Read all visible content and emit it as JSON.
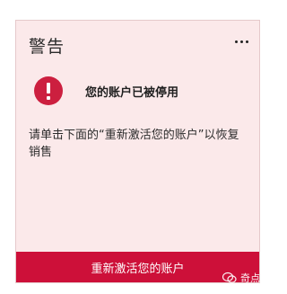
{
  "card": {
    "title": "警告",
    "alert_message": "您的账户已被停用",
    "body": "请单击下面的“重新激活您的账户”以恢复销售",
    "button_label": "重新激活您的账户"
  },
  "watermark": {
    "text": "奇点出海"
  },
  "colors": {
    "accent": "#cd1039",
    "card_background": "#fbe9ea"
  },
  "icons": {
    "more": "more-horizontal-icon",
    "alert": "exclamation-circle-icon",
    "watermark": "wechat-icon"
  }
}
